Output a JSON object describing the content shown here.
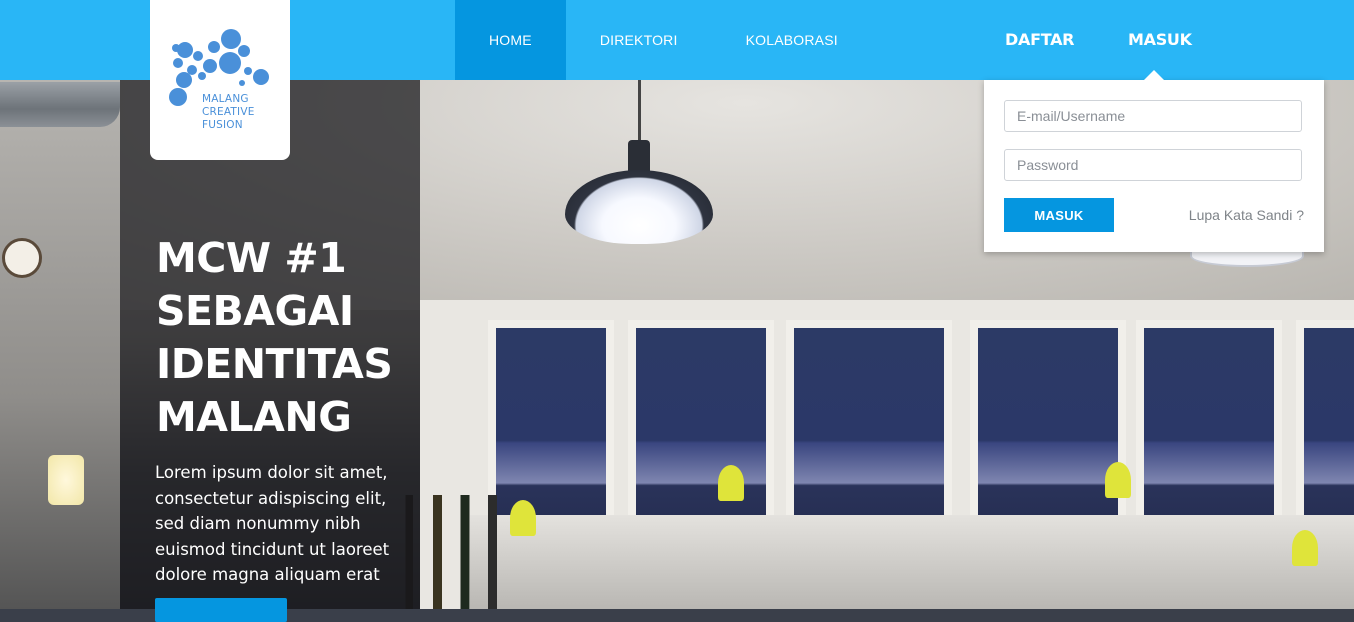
{
  "brand": {
    "name_lines": [
      "MALANG",
      "CREATIVE",
      "FUSION"
    ],
    "logo_icon": "bubble-cluster-icon",
    "logo_color": "#4a90d9"
  },
  "nav": {
    "items": [
      {
        "label": "HOME",
        "active": true
      },
      {
        "label": "DIREKTORI",
        "active": false
      },
      {
        "label": "KOLABORASI",
        "active": false
      }
    ],
    "register_label": "DAFTAR",
    "login_label": "MASUK"
  },
  "login": {
    "email_placeholder": "E-mail/Username",
    "email_value": "",
    "password_placeholder": "Password",
    "password_value": "",
    "submit_label": "MASUK",
    "forgot_label": "Lupa Kata Sandi ?"
  },
  "hero": {
    "headline_lines": [
      "MCW #1",
      "SEBAGAI",
      "IDENTITAS",
      "MALANG"
    ],
    "description": "Lorem ipsum dolor sit amet, consectetur adispiscing elit, sed diam nonummy nibh euismod tincidunt ut laoreet dolore magna aliquam erat"
  },
  "colors": {
    "topbar": "#29b6f6",
    "active_nav": "#0596e0",
    "button": "#0596e0",
    "panel_bg": "#ffffff"
  }
}
